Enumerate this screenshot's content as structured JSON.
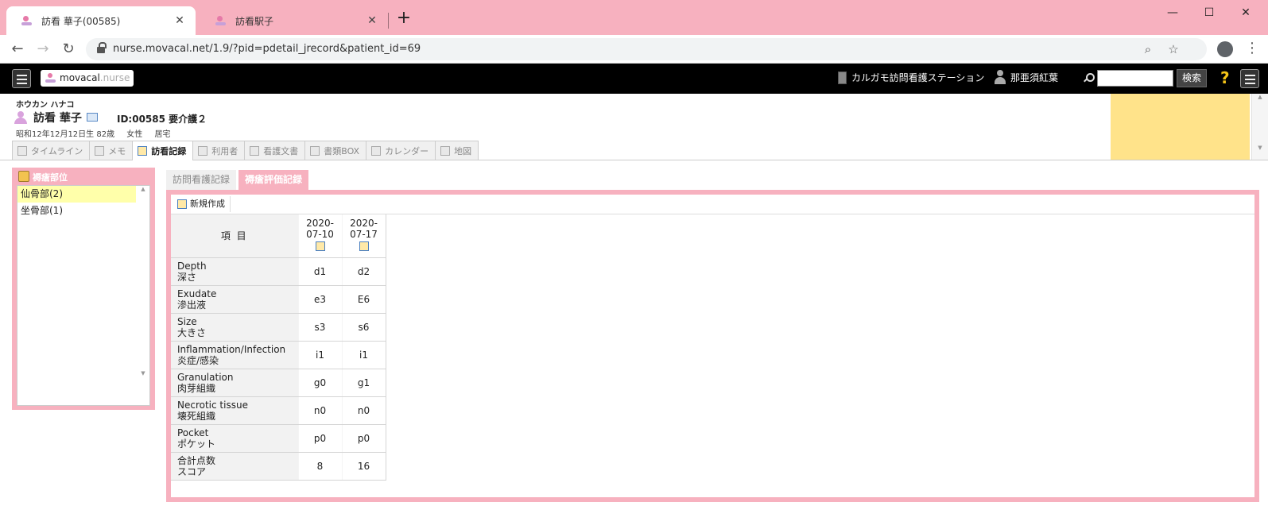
{
  "browser": {
    "tabs": [
      {
        "title": "訪看 華子(00585)",
        "close": "✕"
      },
      {
        "title": "訪看駅子",
        "close": "✕"
      }
    ],
    "new_tab": "+",
    "window": {
      "minimize": "—",
      "maximize": "☐",
      "close": "✕"
    },
    "url": "nurse.movacal.net/1.9/?pid=pdetail_jrecord&patient_id=69"
  },
  "header": {
    "logo_main": "movacal",
    "logo_sub": ".nurse",
    "station": "カルガモ訪問看護ステーション",
    "user": "那亜須紅葉",
    "search_button": "検索",
    "help": "?"
  },
  "patient": {
    "kana": "ホウカン ハナコ",
    "name": "訪看 華子",
    "id_label": "ID:00585 要介護２",
    "birth": "昭和12年12月12日生 82歳",
    "sex": "女性",
    "residence": "居宅"
  },
  "nav_tabs": [
    {
      "label": "タイムライン",
      "icon": "timeline-icon"
    },
    {
      "label": "メモ",
      "icon": "pencil-icon"
    },
    {
      "label": "訪看記録",
      "icon": "record-icon"
    },
    {
      "label": "利用者",
      "icon": "user-card-icon"
    },
    {
      "label": "看護文書",
      "icon": "document-icon"
    },
    {
      "label": "書類BOX",
      "icon": "box-icon"
    },
    {
      "label": "カレンダー",
      "icon": "calendar-icon"
    },
    {
      "label": "地図",
      "icon": "map-icon"
    }
  ],
  "left_panel": {
    "title": "褥瘡部位",
    "items": [
      {
        "label": "仙骨部(2)",
        "selected": true
      },
      {
        "label": "坐骨部(1)",
        "selected": false
      }
    ]
  },
  "sub_tabs": [
    {
      "label": "訪問看護記録"
    },
    {
      "label": "褥瘡評価記録"
    }
  ],
  "toolbar": {
    "new_label": "新規作成"
  },
  "table": {
    "header_item": "項 目",
    "dates": [
      {
        "line1": "2020-",
        "line2": "07-10"
      },
      {
        "line1": "2020-",
        "line2": "07-17"
      }
    ],
    "rows": [
      {
        "en": "Depth",
        "ja": "深さ",
        "v1": "d1",
        "v2": "d2"
      },
      {
        "en": "Exudate",
        "ja": "滲出液",
        "v1": "e3",
        "v2": "E6"
      },
      {
        "en": "Size",
        "ja": "大きさ",
        "v1": "s3",
        "v2": "s6"
      },
      {
        "en": "Inflammation/Infection",
        "ja": "炎症/感染",
        "v1": "i1",
        "v2": "i1"
      },
      {
        "en": "Granulation",
        "ja": "肉芽組織",
        "v1": "g0",
        "v2": "g1"
      },
      {
        "en": "Necrotic tissue",
        "ja": "壊死組織",
        "v1": "n0",
        "v2": "n0"
      },
      {
        "en": "Pocket",
        "ja": "ポケット",
        "v1": "p0",
        "v2": "p0"
      },
      {
        "en": "合計点数",
        "ja": "スコア",
        "v1": "8",
        "v2": "16"
      }
    ]
  },
  "colors": {
    "accent_pink": "#f7b1bf",
    "memo_yellow": "#ffe38a",
    "header_black": "#000000"
  }
}
